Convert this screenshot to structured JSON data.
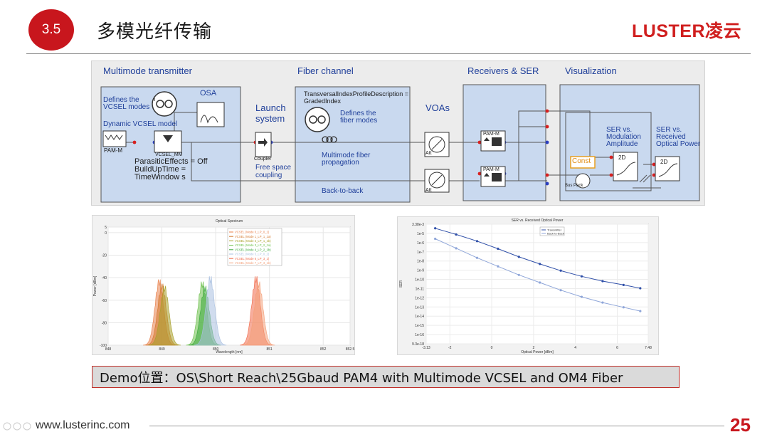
{
  "header": {
    "section_number": "3.5",
    "title": "多模光纤传输",
    "logo": "LUSTER凌云"
  },
  "diagram": {
    "sections": {
      "transmitter": "Multimode transmitter",
      "fiber": "Fiber channel",
      "receivers": "Receivers & SER",
      "visualization": "Visualization"
    },
    "defines_vcsel": [
      "Defines the",
      "VCSEL modes"
    ],
    "dynamic_vcsel": "Dynamic VCSEL model",
    "osa": "OSA",
    "pam_m": "PAM-M",
    "vcsel_mm": "VCSEL_MM",
    "parasitic": [
      "ParasiticEffects = Off",
      "BuildUpTime =",
      "TimeWindow s"
    ],
    "launch": [
      "Launch",
      "system"
    ],
    "coupler": "Coupler",
    "free_space": [
      "Free space",
      "coupling"
    ],
    "profile": [
      "TransversalIndexProfileDescription =",
      "GradedIndex"
    ],
    "fiber_modes": [
      "Defines the",
      "fiber modes"
    ],
    "mm_fiber": [
      "Multimode fiber",
      "propagation"
    ],
    "back_to_back": "Back-to-back",
    "voas": "VOAs",
    "att": "Att",
    "ser_mod": [
      "SER vs.",
      "Modulation",
      "Amplitude"
    ],
    "ser_opt": [
      "SER vs.",
      "Received",
      "Optical Power"
    ],
    "const": "Const",
    "bus_pack": "Bus Pack",
    "twod": "2D"
  },
  "spectrum_plot": {
    "title": "Optical Spectrum",
    "xlabel": "Wavelength [nm]",
    "ylabel": "Power [dBm]",
    "y_ticks": [
      "5",
      "0",
      "-20",
      "-40",
      "-60",
      "-80",
      "-100"
    ],
    "x_ticks": [
      "848",
      "849",
      "850",
      "851",
      "852",
      "852.5"
    ],
    "legend": [
      "VCSEL (Mode 0_LP_0_1)",
      "VCSEL (Mode 1_LP_1_1a)",
      "VCSEL (Mode 2_LP_1_1b)",
      "VCSEL (Mode 3_LP_2_1a)",
      "VCSEL (Mode 4_LP_2_1b)",
      "VCSEL (Mode 5_LP_0_2)",
      "VCSEL (Mode 6_LP_3_1)",
      "VCSEL (Mode 7_LP_3_1b)"
    ],
    "colors": [
      "#e87f4a",
      "#d4792f",
      "#a8a02a",
      "#6cc04a",
      "#3aa83a",
      "#a9c0e0",
      "#f06a4a",
      "#f4a07a"
    ]
  },
  "ser_plot": {
    "title": "SER vs. Received Optical Power",
    "xlabel": "Optical Power [dBm]",
    "ylabel": "SER",
    "y_ticks": [
      "3.38e-3",
      "1e-5",
      "1e-6",
      "1e-7",
      "1e-8",
      "1e-9",
      "1e-10",
      "1e-11",
      "1e-12",
      "1e-13",
      "1e-14",
      "1e-15",
      "1e-16",
      "9.3e-18"
    ],
    "x_ticks": [
      "-3.13",
      "-2",
      "0",
      "2",
      "4",
      "6",
      "7.48"
    ],
    "legend": [
      "Transmitter",
      "Back-to-Back"
    ],
    "colors": [
      "#2f4fa8",
      "#8fa6d9"
    ]
  },
  "chart_data": [
    {
      "type": "area",
      "title": "Optical Spectrum",
      "xlabel": "Wavelength [nm]",
      "ylabel": "Power [dBm]",
      "xlim": [
        848,
        852.5
      ],
      "ylim": [
        -100,
        5
      ],
      "series": [
        {
          "name": "VCSEL (Mode 0_LP_0_1)",
          "peak_x": 848.95,
          "peak_y": -38
        },
        {
          "name": "VCSEL (Mode 1_LP_1_1a)",
          "peak_x": 849.0,
          "peak_y": -42
        },
        {
          "name": "VCSEL (Mode 2_LP_1_1b)",
          "peak_x": 849.05,
          "peak_y": -44
        },
        {
          "name": "VCSEL (Mode 3_LP_2_1a)",
          "peak_x": 849.75,
          "peak_y": -40
        },
        {
          "name": "VCSEL (Mode 4_LP_2_1b)",
          "peak_x": 849.8,
          "peak_y": -44
        },
        {
          "name": "VCSEL (Mode 5_LP_0_2)",
          "peak_x": 849.9,
          "peak_y": -35
        },
        {
          "name": "VCSEL (Mode 6_LP_3_1)",
          "peak_x": 850.75,
          "peak_y": -35
        },
        {
          "name": "VCSEL (Mode 7_LP_3_1b)",
          "peak_x": 850.8,
          "peak_y": -40
        }
      ]
    },
    {
      "type": "line",
      "title": "SER vs. Received Optical Power",
      "xlabel": "Optical Power [dBm]",
      "ylabel": "SER",
      "xlim": [
        -3.13,
        7.48
      ],
      "log_y": true,
      "ylim_exp": [
        -17.03,
        -4.47
      ],
      "x": [
        -2.7,
        -1.7,
        -0.7,
        0.3,
        1.3,
        2.3,
        3.3,
        4.3,
        5.3,
        6.3,
        7.1
      ],
      "series": [
        {
          "name": "Transmitter",
          "values_exp": [
            -4.9,
            -5.55,
            -6.25,
            -7.05,
            -7.9,
            -8.65,
            -9.35,
            -9.95,
            -10.45,
            -10.85,
            -11.2
          ]
        },
        {
          "name": "Back-to-Back",
          "values_exp": [
            -6.0,
            -7.0,
            -8.0,
            -8.9,
            -9.8,
            -10.6,
            -11.4,
            -12.1,
            -12.7,
            -13.2,
            -13.6
          ]
        }
      ]
    }
  ],
  "demo": {
    "text": "Demo位置：OS\\Short Reach\\25Gbaud PAM4 with Multimode VCSEL and OM4 Fiber"
  },
  "footer": {
    "url": "www.lusterinc.com",
    "page": "25"
  }
}
